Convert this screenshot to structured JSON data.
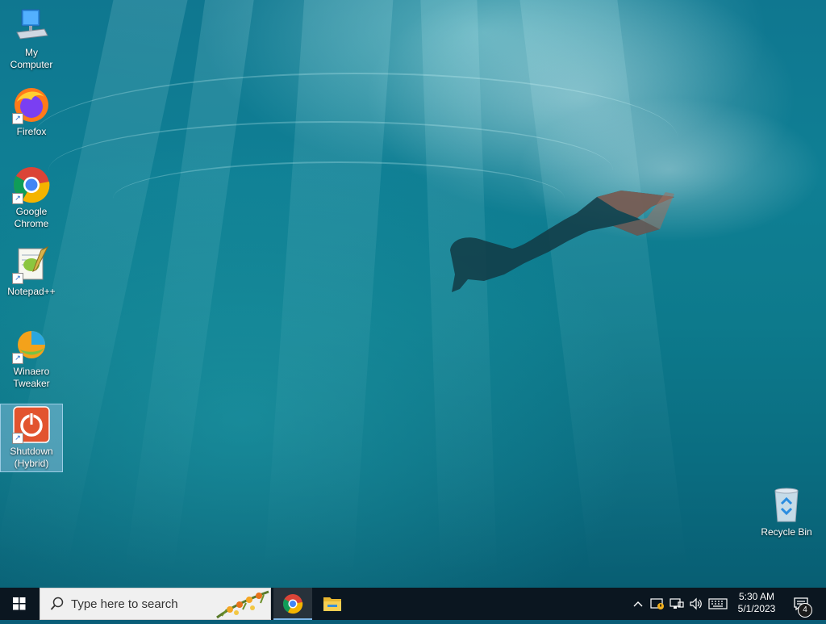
{
  "desktop": {
    "icons": [
      {
        "label": "My Computer"
      },
      {
        "label": "Firefox"
      },
      {
        "label": "Google Chrome"
      },
      {
        "label": "Notepad++"
      },
      {
        "label": "Winaero Tweaker"
      },
      {
        "label": "Shutdown (Hybrid)"
      },
      {
        "label": "Recycle Bin"
      }
    ]
  },
  "taskbar": {
    "search_placeholder": "Type here to search",
    "pinned": [
      "Google Chrome",
      "File Explorer"
    ],
    "clock": {
      "time": "5:30 AM",
      "date": "5/1/2023"
    },
    "notification_count": "4"
  },
  "colors": {
    "taskbar_bg": "#0b1620",
    "accent": "#7cb6e8",
    "search_bg": "#f0f0f0"
  }
}
